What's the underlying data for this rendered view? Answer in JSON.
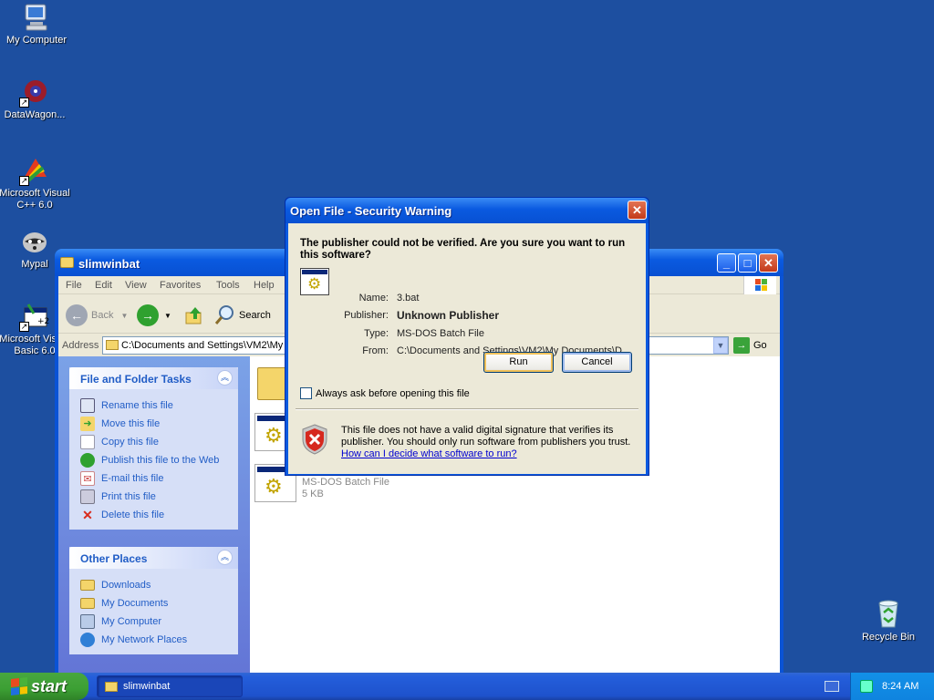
{
  "desktop": {
    "icons": [
      {
        "label": "My Computer"
      },
      {
        "label": "DataWagon..."
      },
      {
        "label": "Microsoft Visual C++ 6.0"
      },
      {
        "label": "Mypal"
      },
      {
        "label": "Microsoft Visual Basic 6.0"
      }
    ],
    "recycle_bin": "Recycle Bin"
  },
  "explorer": {
    "title": "slimwinbat",
    "menu": [
      "File",
      "Edit",
      "View",
      "Favorites",
      "Tools",
      "Help"
    ],
    "toolbar": {
      "back": "Back",
      "search": "Search"
    },
    "address": {
      "label": "Address",
      "value": "C:\\Documents and Settings\\VM2\\My",
      "go": "Go"
    },
    "file_tasks": {
      "title": "File and Folder Tasks",
      "items": [
        {
          "label": "Rename this file",
          "icon": "rename-icon"
        },
        {
          "label": "Move this file",
          "icon": "move-icon"
        },
        {
          "label": "Copy this file",
          "icon": "copy-icon"
        },
        {
          "label": "Publish this file to the Web",
          "icon": "globe-icon"
        },
        {
          "label": "E-mail this file",
          "icon": "email-icon"
        },
        {
          "label": "Print this file",
          "icon": "print-icon"
        },
        {
          "label": "Delete this file",
          "icon": "delete-icon"
        }
      ]
    },
    "other_places": {
      "title": "Other Places",
      "items": [
        {
          "label": "Downloads",
          "icon": "folder-icon"
        },
        {
          "label": "My Documents",
          "icon": "documents-icon"
        },
        {
          "label": "My Computer",
          "icon": "computer-icon"
        },
        {
          "label": "My Network Places",
          "icon": "network-icon"
        }
      ]
    },
    "files": [
      {
        "type": "MS-DOS Batch File",
        "size": "5 KB"
      }
    ]
  },
  "dialog": {
    "title": "Open File - Security Warning",
    "question": "The publisher could not be verified.  Are you sure you want to run this software?",
    "fields": {
      "name_label": "Name:",
      "name_value": "3.bat",
      "publisher_label": "Publisher:",
      "publisher_value": "Unknown Publisher",
      "type_label": "Type:",
      "type_value": "MS-DOS Batch File",
      "from_label": "From:",
      "from_value": "C:\\Documents and Settings\\VM2\\My Documents\\D..."
    },
    "run_label": "Run",
    "cancel_label": "Cancel",
    "checkbox_label": "Always ask before opening this file",
    "checkbox_checked": false,
    "warning_text": "This file does not have a valid digital signature that verifies its publisher.  You should only run software from publishers you trust.",
    "warning_link": "How can I decide what software to run?"
  },
  "taskbar": {
    "start_label": "start",
    "window_button": "slimwinbat",
    "clock": "8:24 AM"
  },
  "colors": {
    "desktop_bg": "#1d4fa0",
    "title_blue": "#0a5ae0",
    "start_green": "#3c9f34",
    "link_blue": "#215dc6"
  }
}
